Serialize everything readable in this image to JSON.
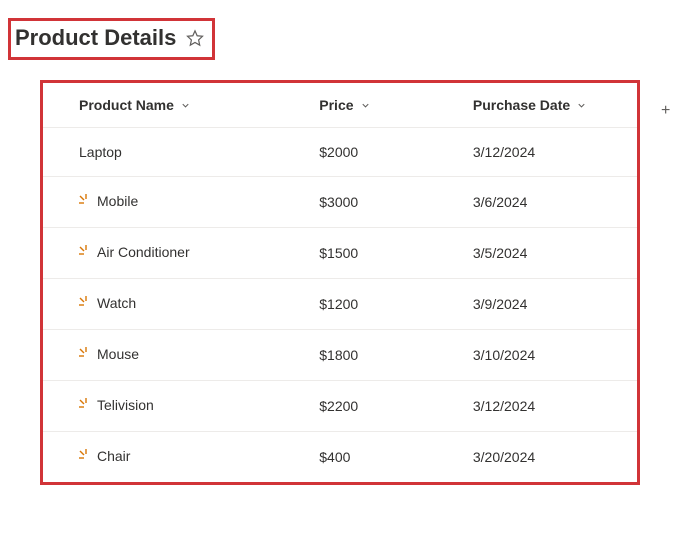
{
  "header": {
    "title": "Product Details"
  },
  "table": {
    "columns": {
      "name": "Product Name",
      "price": "Price",
      "date": "Purchase Date"
    },
    "rows": [
      {
        "name": "Laptop",
        "price": "$2000",
        "date": "3/12/2024",
        "spark": false
      },
      {
        "name": "Mobile",
        "price": "$3000",
        "date": "3/6/2024",
        "spark": true
      },
      {
        "name": "Air Conditioner",
        "price": "$1500",
        "date": "3/5/2024",
        "spark": true
      },
      {
        "name": "Watch",
        "price": "$1200",
        "date": "3/9/2024",
        "spark": true
      },
      {
        "name": "Mouse",
        "price": "$1800",
        "date": "3/10/2024",
        "spark": true
      },
      {
        "name": "Telivision",
        "price": "$2200",
        "date": "3/12/2024",
        "spark": true
      },
      {
        "name": "Chair",
        "price": "$400",
        "date": "3/20/2024",
        "spark": true
      }
    ]
  }
}
